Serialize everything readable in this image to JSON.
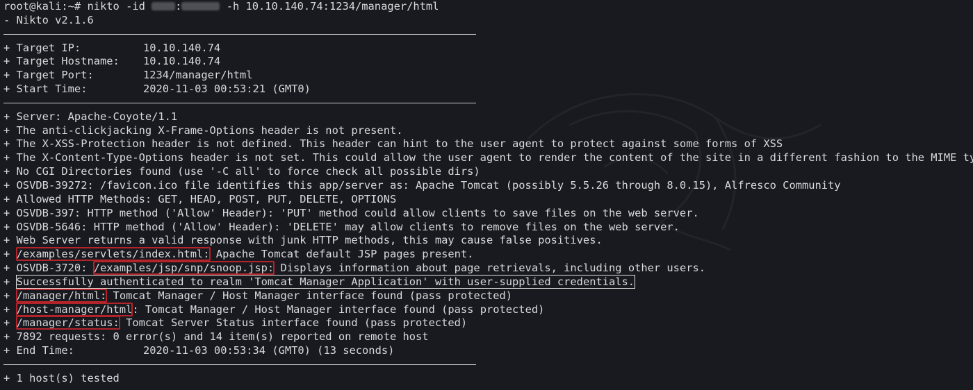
{
  "prompt": "root@kali:~#",
  "command": {
    "text_before": " nikto -id ",
    "sep": ":",
    "text_after": " -h 10.10.140.74:1234/manager/html"
  },
  "version": "- Nikto v2.1.6",
  "target": [
    {
      "label": "+ Target IP:",
      "value": "10.10.140.74"
    },
    {
      "label": "+ Target Hostname:",
      "value": "10.10.140.74"
    },
    {
      "label": "+ Target Port:",
      "value": "1234/manager/html"
    },
    {
      "label": "+ Start Time:",
      "value": "2020-11-03 00:53:21 (GMT0)"
    }
  ],
  "findings": {
    "server": "+ Server: Apache-Coyote/1.1",
    "clickjacking": "+ The anti-clickjacking X-Frame-Options header is not present.",
    "xss": "+ The X-XSS-Protection header is not defined. This header can hint to the user agent to protect against some forms of XSS",
    "content_type": "+ The X-Content-Type-Options header is not set. This could allow the user agent to render the content of the site in a different fashion to the MIME type",
    "cgi": "+ No CGI Directories found (use '-C all' to force check all possible dirs)",
    "favicon": "+ OSVDB-39272: /favicon.ico file identifies this app/server as: Apache Tomcat (possibly 5.5.26 through 8.0.15), Alfresco Community",
    "methods": "+ Allowed HTTP Methods: GET, HEAD, POST, PUT, DELETE, OPTIONS",
    "put": "+ OSVDB-397: HTTP method ('Allow' Header): 'PUT' method could allow clients to save files on the web server.",
    "delete": "+ OSVDB-5646: HTTP method ('Allow' Header): 'DELETE' may allow clients to remove files on the web server.",
    "junk": "+ Web Server returns a valid response with junk HTTP methods, this may cause false positives.",
    "examples": {
      "prefix": "+ ",
      "path": "/examples/servlets/index.html:",
      "text": " Apache Tomcat default JSP pages present."
    },
    "snoop": {
      "prefix": "+ OSVDB-3720: ",
      "path": "/examples/jsp/snp/snoop.jsp:",
      "text": " Displays information about page retrievals, including other users."
    },
    "auth": {
      "prefix": "+ ",
      "text": "Successfully authenticated to realm 'Tomcat Manager Application' with user-supplied credentials."
    },
    "manager": {
      "prefix": "+ ",
      "path": "/manager/html:",
      "text": " Tomcat Manager / Host Manager interface found (pass protected)"
    },
    "host_manager": {
      "prefix": "+ ",
      "path": "/host-manager/html",
      "text": ": Tomcat Manager / Host Manager interface found (pass protected)"
    },
    "status": {
      "prefix": "+ ",
      "path": "/manager/status:",
      "text": " Tomcat Server Status interface found (pass protected)"
    },
    "requests": "+ 7892 requests: 0 error(s) and 14 item(s) reported on remote host",
    "end_label": "+ End Time:",
    "end_value": "2020-11-03 00:53:34 (GMT0) (13 seconds)"
  },
  "footer": "+ 1 host(s) tested",
  "colors": {
    "background": "#191a20",
    "text": "#d9dadc",
    "highlight_red": "#b3242a",
    "highlight_white": "#e6e6e6"
  }
}
